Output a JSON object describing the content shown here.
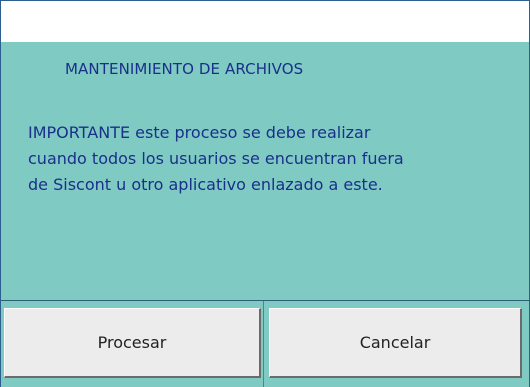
{
  "dialog": {
    "heading": "MANTENIMIENTO DE ARCHIVOS",
    "message_lines": [
      "IMPORTANTE este proceso se debe realizar",
      "cuando todos los usuarios se encuentran fuera",
      "de Siscont u otro aplicativo enlazado a este."
    ],
    "buttons": {
      "process_label": "Procesar",
      "cancel_label": "Cancelar"
    }
  },
  "colors": {
    "background": "#7fcbc3",
    "text": "#1a2f8a",
    "button_face": "#ececec"
  }
}
